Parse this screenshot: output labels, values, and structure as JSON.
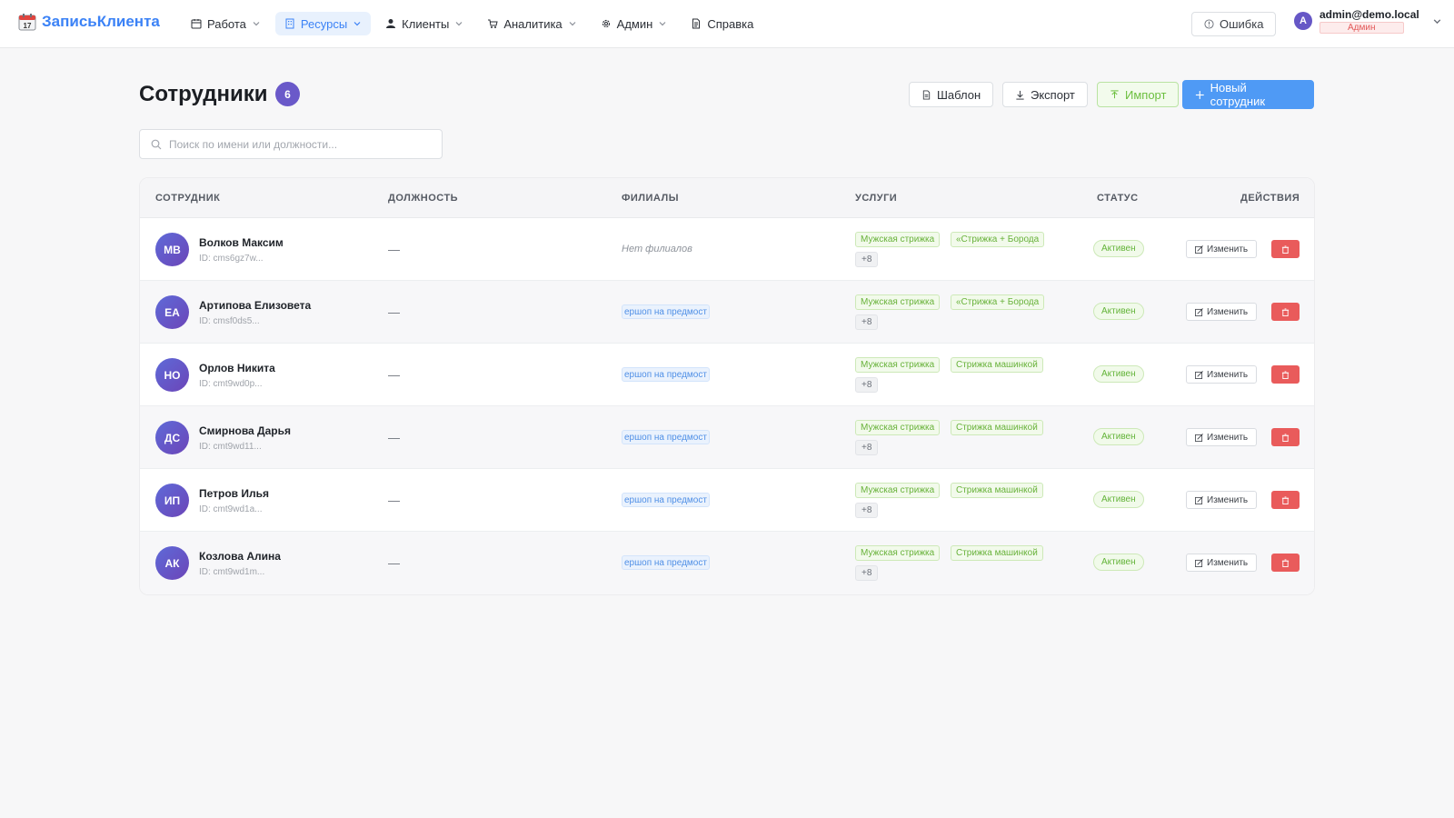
{
  "app": {
    "brand": "ЗаписьКлиента"
  },
  "nav": {
    "items": [
      {
        "label": "Работа",
        "icon": "calendar-icon",
        "dropdown": true,
        "active": false
      },
      {
        "label": "Ресурсы",
        "icon": "building-icon",
        "dropdown": true,
        "active": true
      },
      {
        "label": "Клиенты",
        "icon": "user-icon",
        "dropdown": true,
        "active": false
      },
      {
        "label": "Аналитика",
        "icon": "cart-icon",
        "dropdown": true,
        "active": false
      },
      {
        "label": "Админ",
        "icon": "gear-icon",
        "dropdown": true,
        "active": false
      },
      {
        "label": "Справка",
        "icon": "document-icon",
        "dropdown": false,
        "active": false
      }
    ],
    "error_button": "Ошибка",
    "user": {
      "avatar_letter": "A",
      "email": "admin@demo.local",
      "role": "Админ"
    }
  },
  "page": {
    "title": "Сотрудники",
    "count": "6",
    "buttons": {
      "template": "Шаблон",
      "export": "Экспорт",
      "import": "Импорт",
      "new_employee": "Новый сотрудник"
    },
    "search_placeholder": "Поиск по имени или должности..."
  },
  "table": {
    "columns": [
      "СОТРУДНИК",
      "ДОЛЖНОСТЬ",
      "ФИЛИАЛЫ",
      "УСЛУГИ",
      "СТАТУС",
      "ДЕЙСТВИЯ"
    ],
    "edit_label": "Изменить",
    "rows": [
      {
        "initials": "МВ",
        "name": "Волков Максим",
        "id": "ID: cms6gz7w...",
        "position": "—",
        "branch": "Нет филиалов",
        "has_branch": false,
        "services": [
          "Мужская стрижка",
          "«Стрижка + Борода"
        ],
        "more": "+8",
        "status": "Активен"
      },
      {
        "initials": "ЕА",
        "name": "Артипова Елизовета",
        "id": "ID: cmsf0ds5...",
        "position": "—",
        "branch": "ершоп на предмост",
        "has_branch": true,
        "services": [
          "Мужская стрижка",
          "«Стрижка + Борода"
        ],
        "more": "+8",
        "status": "Активен"
      },
      {
        "initials": "НО",
        "name": "Орлов Никита",
        "id": "ID: cmt9wd0p...",
        "position": "—",
        "branch": "ершоп на предмост",
        "has_branch": true,
        "services": [
          "Мужская стрижка",
          "Стрижка машинкой"
        ],
        "more": "+8",
        "status": "Активен"
      },
      {
        "initials": "ДС",
        "name": "Смирнова Дарья",
        "id": "ID: cmt9wd11...",
        "position": "—",
        "branch": "ершоп на предмост",
        "has_branch": true,
        "services": [
          "Мужская стрижка",
          "Стрижка машинкой"
        ],
        "more": "+8",
        "status": "Активен"
      },
      {
        "initials": "ИП",
        "name": "Петров Илья",
        "id": "ID: cmt9wd1a...",
        "position": "—",
        "branch": "ершоп на предмост",
        "has_branch": true,
        "services": [
          "Мужская стрижка",
          "Стрижка машинкой"
        ],
        "more": "+8",
        "status": "Активен"
      },
      {
        "initials": "АК",
        "name": "Козлова Алина",
        "id": "ID: cmt9wd1m...",
        "position": "—",
        "branch": "ершоп на предмост",
        "has_branch": true,
        "services": [
          "Мужская стрижка",
          "Стрижка машинкой"
        ],
        "more": "+8",
        "status": "Активен"
      }
    ]
  },
  "colors": {
    "accent": "#3b82f6",
    "badge": "#6a59c9",
    "success": "#64b43a",
    "danger": "#e95b5b"
  }
}
